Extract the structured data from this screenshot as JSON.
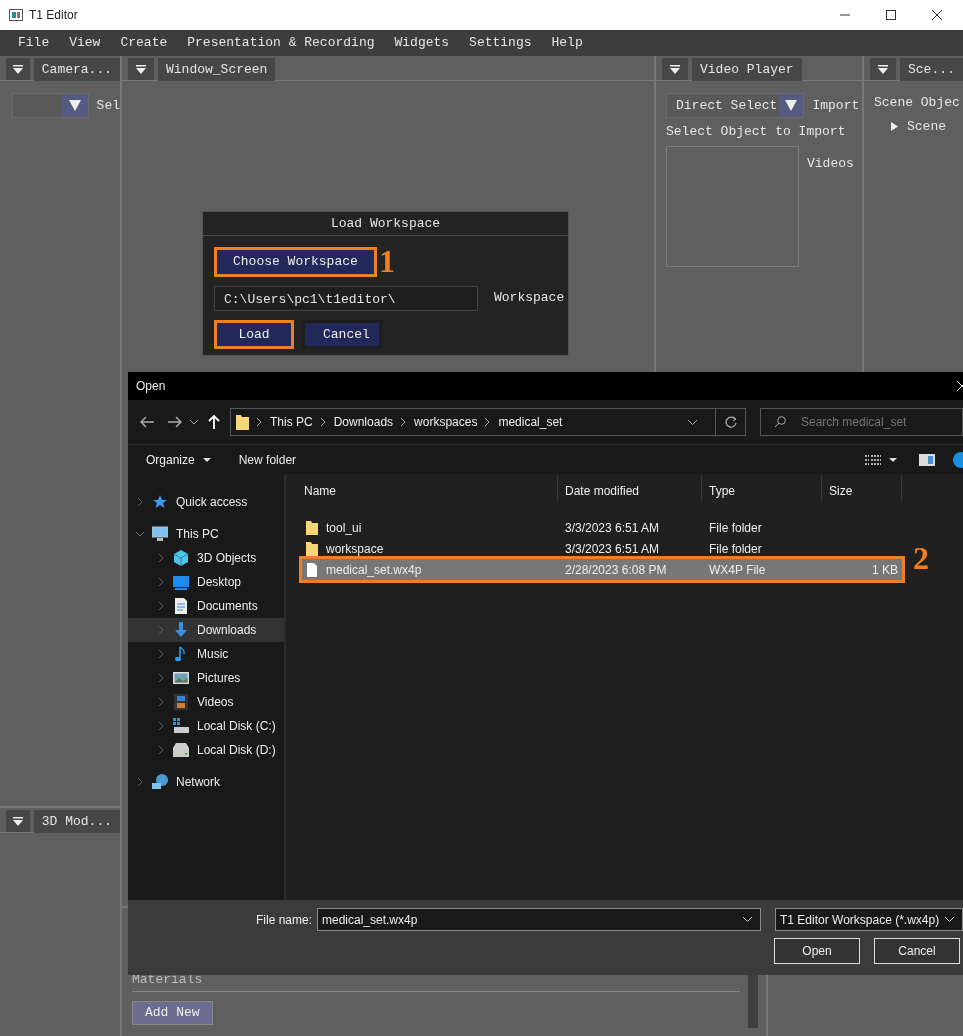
{
  "window": {
    "title": "T1 Editor"
  },
  "menu": [
    "File",
    "View",
    "Create",
    "Presentation & Recording",
    "Widgets",
    "Settings",
    "Help"
  ],
  "camera_panel": {
    "tab": "Camera...",
    "label": "Sel"
  },
  "window_screen_panel": {
    "tab": "Window_Screen"
  },
  "video_player_panel": {
    "tab": "Video Player",
    "dropdown": "Direct Select",
    "import_label": "Import",
    "select_label": "Select Object to Import",
    "list_label": "Videos"
  },
  "scene_panel": {
    "tab": "Sce...",
    "heading": "Scene Objec",
    "tree": [
      {
        "label": "Scene",
        "expanded": false
      }
    ]
  },
  "model_panel": {
    "tab": "3D Mod..."
  },
  "materials_panel": {
    "heading": "Materials",
    "add_button": "Add New"
  },
  "load_workspace": {
    "title": "Load Workspace",
    "choose_button": {
      "label": "Choose Workspace",
      "highlighted": true
    },
    "path": "C:\\Users\\pc1\\t1editor\\",
    "path_label": "Workspace",
    "buttons": [
      {
        "label": "Load",
        "highlighted": true
      },
      {
        "label": "Cancel",
        "highlighted": false
      }
    ]
  },
  "annotations": [
    {
      "label": "1"
    },
    {
      "label": "2"
    }
  ],
  "open_dialog": {
    "title": "Open",
    "breadcrumb": [
      "This PC",
      "Downloads",
      "workspaces",
      "medical_set"
    ],
    "search": {
      "placeholder": "Search medical_set"
    },
    "toolbar": [
      "Organize",
      "New folder"
    ],
    "nav": [
      {
        "label": "Quick access",
        "kind": "star",
        "selected": false
      },
      {
        "label": "This PC",
        "kind": "computer",
        "selected": false,
        "expanded": true,
        "children": [
          {
            "label": "3D Objects",
            "kind": "cube",
            "selected": false
          },
          {
            "label": "Desktop",
            "kind": "desktop",
            "selected": false
          },
          {
            "label": "Documents",
            "kind": "document",
            "selected": false
          },
          {
            "label": "Downloads",
            "kind": "download",
            "selected": true
          },
          {
            "label": "Music",
            "kind": "music",
            "selected": false
          },
          {
            "label": "Pictures",
            "kind": "pictures",
            "selected": false
          },
          {
            "label": "Videos",
            "kind": "videos",
            "selected": false
          },
          {
            "label": "Local Disk (C:)",
            "kind": "system-disk",
            "selected": false
          },
          {
            "label": "Local Disk (D:)",
            "kind": "disk",
            "selected": false
          }
        ]
      },
      {
        "label": "Network",
        "kind": "network",
        "selected": false
      }
    ],
    "columns": [
      "Name",
      "Date modified",
      "Type",
      "Size"
    ],
    "rows": [
      {
        "kind": "folder",
        "name": "tool_ui",
        "date": "3/3/2023 6:51 AM",
        "type": "File folder",
        "selected": false,
        "highlighted": false
      },
      {
        "kind": "folder",
        "name": "workspace",
        "date": "3/3/2023 6:51 AM",
        "type": "File folder",
        "selected": false,
        "highlighted": false
      },
      {
        "kind": "file",
        "name": "medical_set.wx4p",
        "date": "2/28/2023 6:08 PM",
        "type": "WX4P File",
        "size": "1 KB",
        "selected": true,
        "highlighted": true
      }
    ],
    "file_name_label": "File name:",
    "file_name": "medical_set.wx4p",
    "file_type": "T1 Editor Workspace (*.wx4p)",
    "buttons": [
      "Open",
      "Cancel"
    ]
  }
}
